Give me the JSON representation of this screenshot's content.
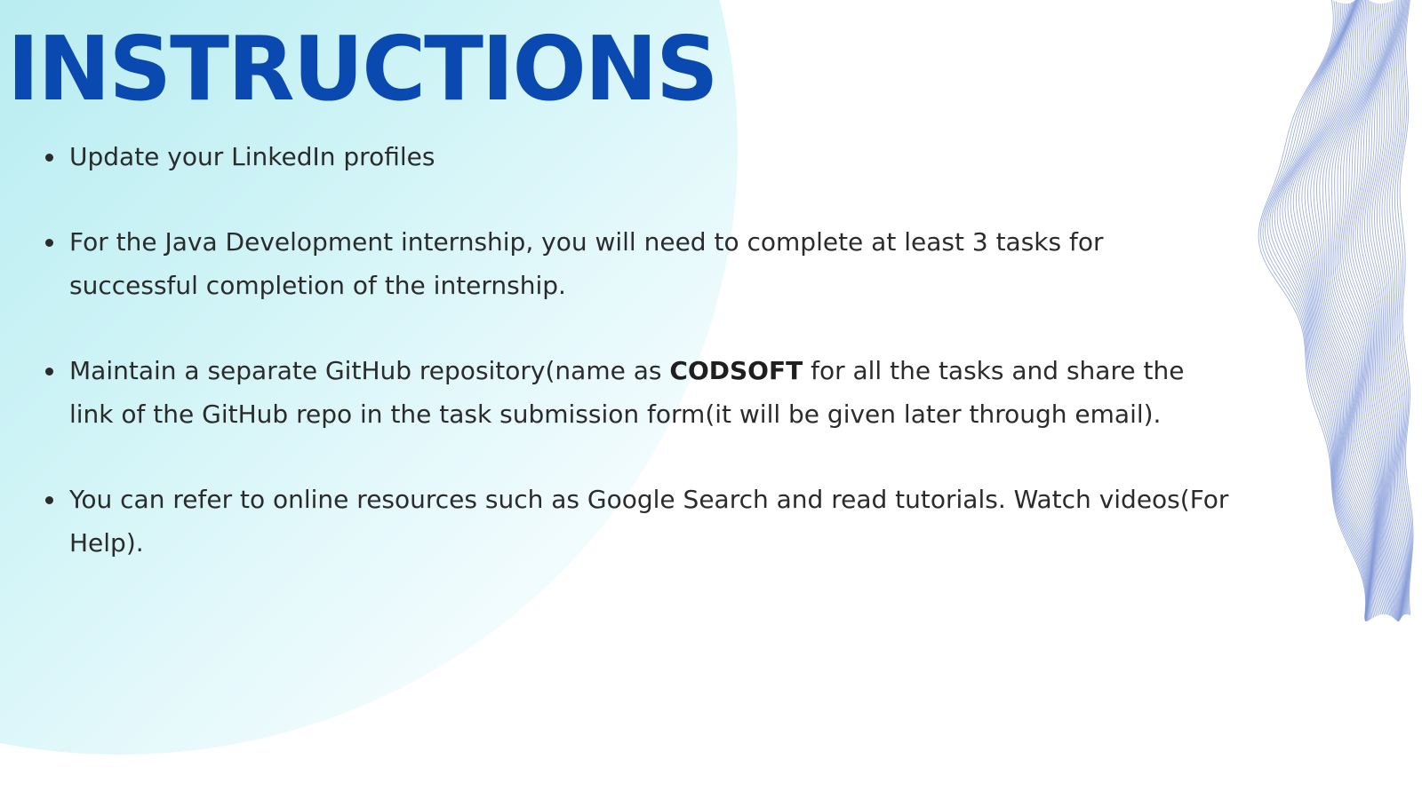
{
  "slide": {
    "title": "INSTRUCTIONS",
    "colors": {
      "title": "#0a4ab0",
      "body_text": "#2b2b2b",
      "blob_gradient_start": "#9fcfe6",
      "blob_gradient_end": "#ffffff",
      "wave_lines": "#7f97d6"
    },
    "decorations": [
      "gradient-circle-blob",
      "wavy-line-pattern"
    ],
    "bullets": [
      {
        "text": "Update your  LinkedIn profiles"
      },
      {
        "text": "For the Java Development internship, you will need to complete at least 3 tasks for successful completion of the internship."
      },
      {
        "before": "Maintain a separate GitHub repository(name as ",
        "bold": "CODSOFT",
        "after": " for all the tasks and share the link of the GitHub repo in the task submission form(it will be given later through email)."
      },
      {
        "text": "You can refer to online resources such as Google Search and read tutorials. Watch videos(For Help)."
      }
    ]
  }
}
